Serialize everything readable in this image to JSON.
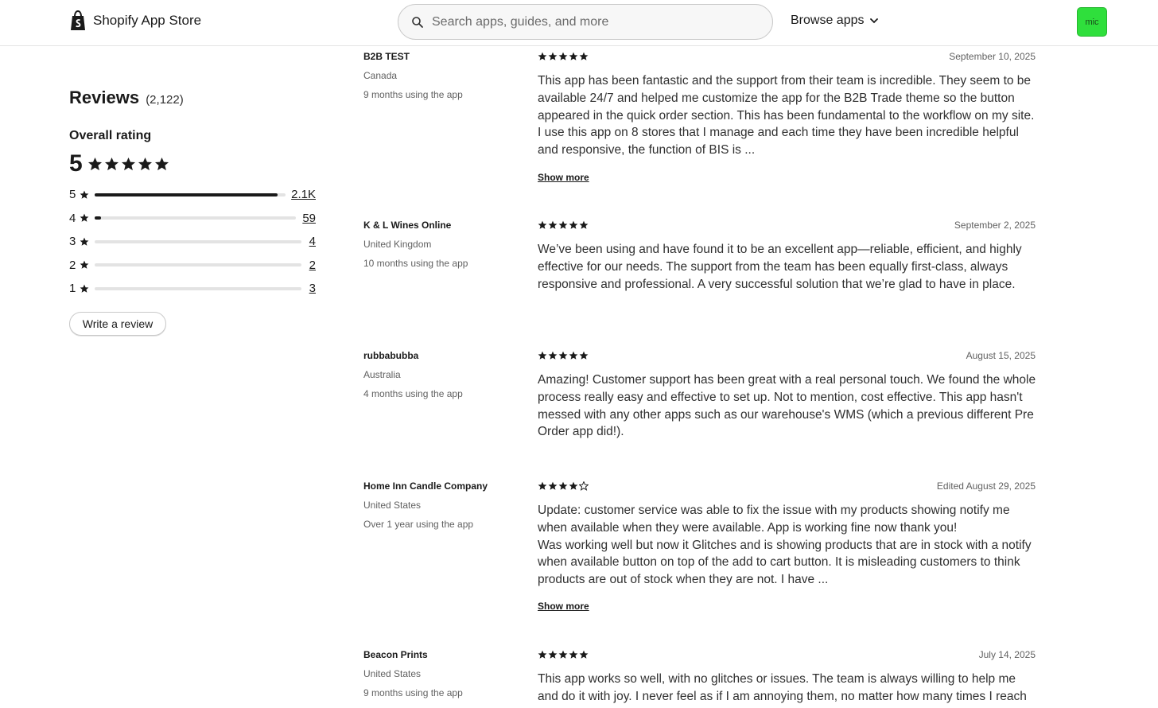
{
  "header": {
    "logo_text": "Shopify App Store",
    "search_placeholder": "Search apps, guides, and more",
    "browse_label": "Browse apps",
    "avatar_initials": "mic",
    "avatar_color": "#2fdf3c"
  },
  "summary": {
    "title": "Reviews",
    "count": "(2,122)",
    "overall_label": "Overall rating",
    "overall_value": "5",
    "overall_stars": 5,
    "distribution": [
      {
        "stars": "5",
        "count": "2.1K",
        "fraction": 0.96
      },
      {
        "stars": "4",
        "count": "59",
        "fraction": 0.03
      },
      {
        "stars": "3",
        "count": "4",
        "fraction": 0.0
      },
      {
        "stars": "2",
        "count": "2",
        "fraction": 0.0
      },
      {
        "stars": "1",
        "count": "3",
        "fraction": 0.0
      }
    ],
    "write_review_label": "Write a review"
  },
  "reviews": [
    {
      "name": "B2B TEST",
      "country": "Canada",
      "duration": "9 months using the app",
      "rating": 5,
      "date": "September 10, 2025",
      "body": "This app has been fantastic and the support from their team is incredible. They seem to be available 24/7 and helped me customize the app for the B2B Trade theme so the button appeared in the quick order section. This has been fundamental to the workflow on my site. I use this app on 8 stores that I manage and each time they have been incredible helpful and responsive, the function of BIS is ...",
      "show_more": "Show more"
    },
    {
      "name": "K & L Wines Online",
      "country": "United Kingdom",
      "duration": "10 months using the app",
      "rating": 5,
      "date": "September 2, 2025",
      "body": "We’ve been using          and have found it to be an excellent app—reliable, efficient, and highly effective for our needs. The support from the           team has been equally first-class, always responsive and professional. A very successful solution that we’re glad to have in place.",
      "show_more": ""
    },
    {
      "name": "rubbabubba",
      "country": "Australia",
      "duration": "4 months using the app",
      "rating": 5,
      "date": "August 15, 2025",
      "body": "Amazing! Customer support has been great with a real personal touch. We found the whole process really easy and effective to set up. Not to mention, cost effective. This app hasn't messed with any other apps such as our warehouse's WMS (which a previous different Pre Order app did!).",
      "show_more": ""
    },
    {
      "name": "Home Inn Candle Company",
      "country": "United States",
      "duration": "Over 1 year using the app",
      "rating": 4,
      "date": "Edited August 29, 2025",
      "body": "Update: customer service was able to fix the issue with my products showing notify me when available when they were available. App is working fine now thank you!\nWas working well but now it Glitches and is showing products that are in stock with a notify when available button on top of the add to cart button. It is misleading customers to think products are out of stock when they are not. I have ...",
      "show_more": "Show more"
    },
    {
      "name": "Beacon Prints",
      "country": "United States",
      "duration": "9 months using the app",
      "rating": 5,
      "date": "July 14, 2025",
      "body": "This app works so well, with no glitches or issues. The team is always willing to help me and do it with joy. I never feel as if I am annoying them, no matter how many times I reach out.",
      "show_more": ""
    }
  ]
}
